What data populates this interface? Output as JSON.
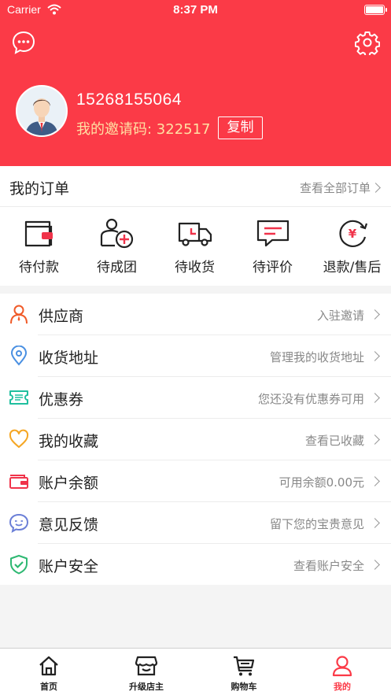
{
  "status_bar": {
    "carrier": "Carrier",
    "time": "8:37 PM"
  },
  "profile": {
    "phone": "15268155064",
    "invite_label": "我的邀请码: 322517",
    "copy_label": "复制"
  },
  "orders": {
    "title": "我的订单",
    "view_all": "查看全部订单",
    "items": [
      {
        "label": "待付款",
        "icon": "wallet-icon"
      },
      {
        "label": "待成团",
        "icon": "group-add-icon"
      },
      {
        "label": "待收货",
        "icon": "truck-icon"
      },
      {
        "label": "待评价",
        "icon": "comment-icon"
      },
      {
        "label": "退款/售后",
        "icon": "refund-icon"
      }
    ]
  },
  "menu": [
    {
      "label": "供应商",
      "hint": "入驻邀请",
      "icon": "person-icon",
      "color": "#f05a28"
    },
    {
      "label": "收货地址",
      "hint": "管理我的收货地址",
      "icon": "location-icon",
      "color": "#4a90e2"
    },
    {
      "label": "优惠券",
      "hint": "您还没有优惠券可用",
      "icon": "ticket-icon",
      "color": "#1fbf9f"
    },
    {
      "label": "我的收藏",
      "hint": "查看已收藏",
      "icon": "heart-icon",
      "color": "#f5a623"
    },
    {
      "label": "账户余额",
      "hint": "可用余额0.00元",
      "icon": "wallet-icon",
      "color": "#f0334a"
    },
    {
      "label": "意见反馈",
      "hint": "留下您的宝贵意见",
      "icon": "smile-icon",
      "color": "#6b7fd7"
    },
    {
      "label": "账户安全",
      "hint": "查看账户安全",
      "icon": "shield-icon",
      "color": "#2eb872"
    }
  ],
  "tabbar": [
    {
      "label": "首页",
      "icon": "home-icon",
      "active": false
    },
    {
      "label": "升级店主",
      "icon": "store-icon",
      "active": false
    },
    {
      "label": "购物车",
      "icon": "cart-icon",
      "active": false
    },
    {
      "label": "我的",
      "icon": "user-icon",
      "active": true
    }
  ],
  "colors": {
    "brand": "#fb3a47",
    "invite_text": "#ffe0a3"
  }
}
